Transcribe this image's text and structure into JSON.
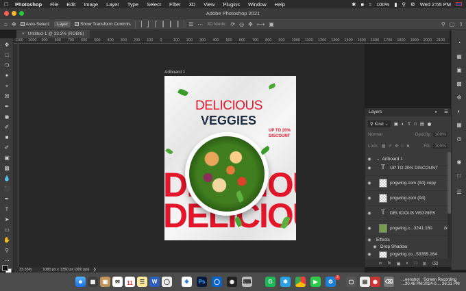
{
  "menubar": {
    "items": [
      "Photoshop",
      "File",
      "Edit",
      "Image",
      "Layer",
      "Type",
      "Select",
      "Filter",
      "3D",
      "View",
      "Plugins",
      "Window",
      "Help"
    ],
    "battery": "100%",
    "clock": "Wed 2:55 PM"
  },
  "window": {
    "title": "Adobe Photoshop 2021"
  },
  "options": {
    "auto_select_label": "Auto-Select:",
    "auto_select_value": "Layer",
    "show_transform_label": "Show Transform Controls",
    "mode_label": "3D Mode:"
  },
  "document": {
    "tab_label": "Untitled-1 @ 33.3% (RGB/8)",
    "close_glyph": "×"
  },
  "ruler": {
    "ticks": [
      "1100",
      "1000",
      "900",
      "800",
      "700",
      "600",
      "500",
      "400",
      "300",
      "200",
      "100",
      "0",
      "100",
      "200",
      "300",
      "400",
      "500",
      "600",
      "700",
      "800",
      "900",
      "1000",
      "1100",
      "1200",
      "1300",
      "1400",
      "1500",
      "1600",
      "1700",
      "1800",
      "1900",
      "2000",
      "2100"
    ]
  },
  "artboard": {
    "name": "Artboard 1",
    "headline_1": "DELICIOUS",
    "headline_2": "VEGGIES",
    "discount_1": "UP TO 20%",
    "discount_2": "DISCOUNT",
    "bg_word_1": "DELICIOUS",
    "bg_word_2": "DELICIOUS"
  },
  "layers_panel": {
    "title": "Layers",
    "filter_value": "Kind",
    "blend_mode": "Normal",
    "opacity_label": "Opacity:",
    "opacity_value": "100%",
    "lock_label": "Lock:",
    "fill_label": "Fill:",
    "fill_value": "100%",
    "group_name": "Artboard 1",
    "layers": [
      "UP TO 20%  DISCOUNT",
      "pngwing.com (94) copy",
      "pngwing.com (94)",
      "DELICIOUS VEGGIES",
      "pngwing.c...3241.160",
      "pngwing.co...53355.164"
    ],
    "effects_label": "Effects",
    "drop_shadow_label": "Drop Shadow",
    "fx_label": "fx"
  },
  "status": {
    "zoom": "33.33%",
    "doc_size": "1080 px x 1350 px (300 ppi)"
  },
  "dock": {
    "calendar_day": "11",
    "calendar_month": "APR",
    "badge_count": "2",
    "label_1": "...eenshot",
    "label_1b": "...30.48 PM",
    "label_2": "Screen Recording",
    "label_2b": "2024-0.... 36.31 PM"
  },
  "colors": {
    "headline_red": "#e3162b",
    "headline_navy": "#1e2b3f",
    "panel_bg": "#3a3a3a",
    "app_bg": "#1e1e1e"
  }
}
